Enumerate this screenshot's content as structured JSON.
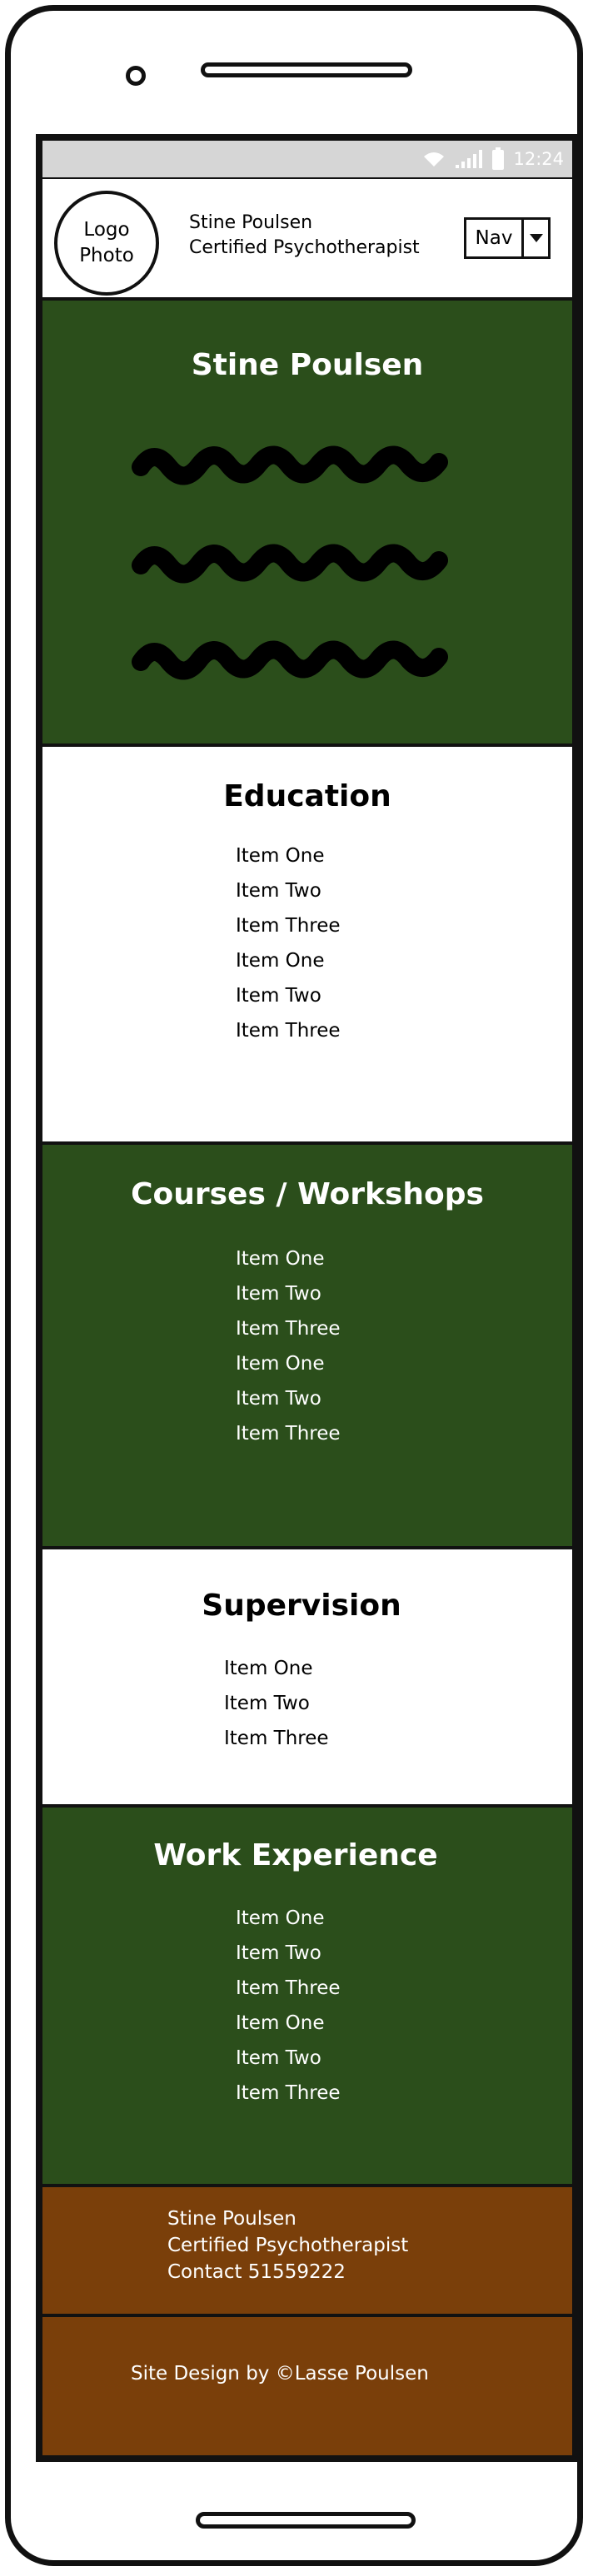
{
  "status_bar": {
    "time": "12:24",
    "icons": [
      "wifi-icon",
      "signal-icon",
      "battery-icon"
    ]
  },
  "header": {
    "logo_line1": "Logo",
    "logo_line2": "Photo",
    "name": "Stine Poulsen",
    "tagline": "Certified Psychotherapist",
    "nav_label": "Nav"
  },
  "hero": {
    "title": "Stine Poulsen"
  },
  "education": {
    "title": "Education",
    "items": [
      "Item One",
      "Item Two",
      "Item Three",
      "Item One",
      "Item Two",
      "Item Three"
    ]
  },
  "courses": {
    "title": "Courses / Workshops",
    "items": [
      "Item One",
      "Item Two",
      "Item Three",
      "Item One",
      "Item Two",
      "Item Three"
    ]
  },
  "supervision": {
    "title": "Supervision",
    "items": [
      "Item One",
      "Item Two",
      "Item Three"
    ]
  },
  "work": {
    "title": "Work Experience",
    "items": [
      "Item One",
      "Item Two",
      "Item Three",
      "Item One",
      "Item Two",
      "Item Three"
    ]
  },
  "contact": {
    "name": "Stine Poulsen",
    "tagline": "Certified Psychotherapist",
    "contact": "Contact 51559222"
  },
  "credit": {
    "text": "Site Design by ©Lasse Poulsen"
  },
  "colors": {
    "green": "#2b4e1b",
    "brown": "#7a3f0a",
    "status_bar": "#d6d6d6"
  }
}
